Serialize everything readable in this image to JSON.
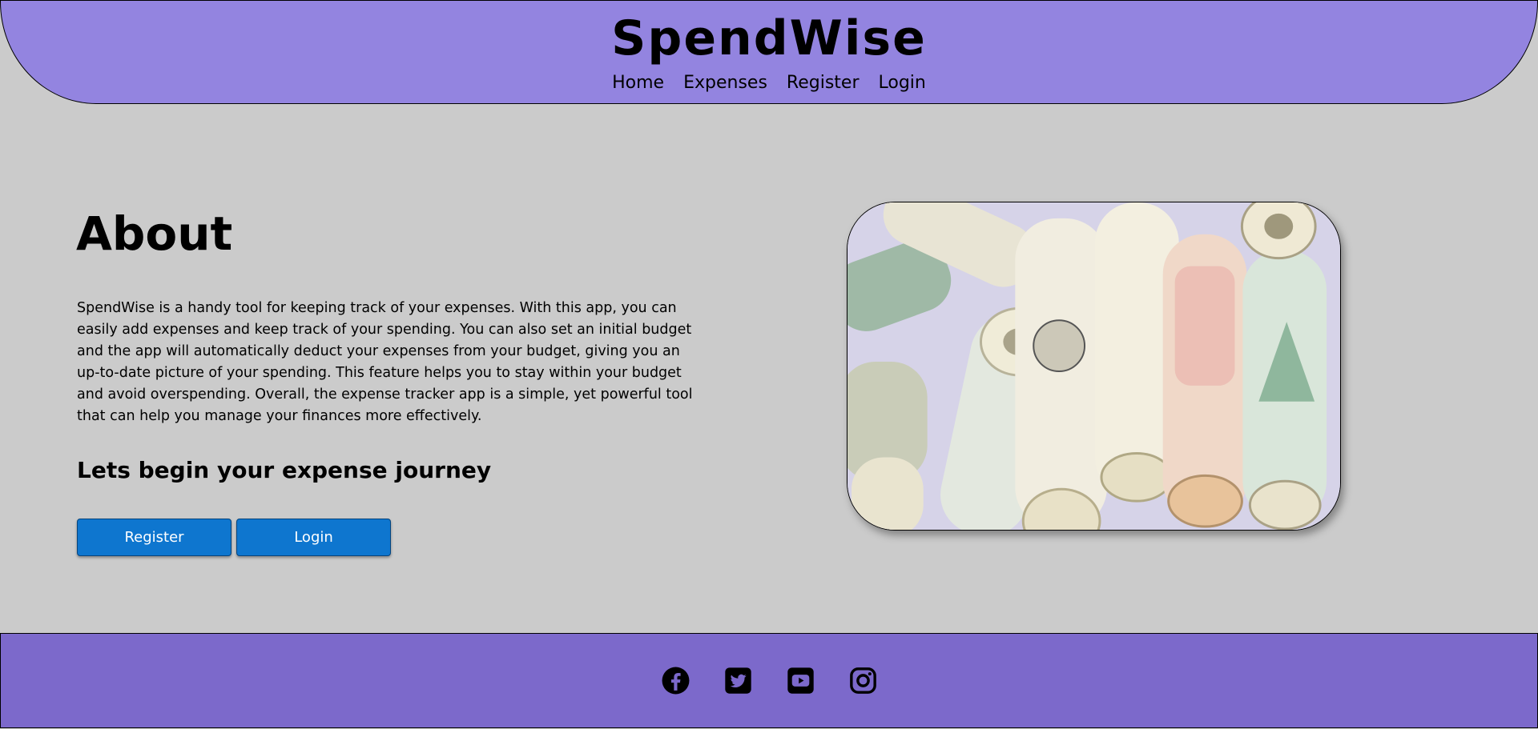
{
  "header": {
    "brand": "SpendWise",
    "nav": [
      "Home",
      "Expenses",
      "Register",
      "Login"
    ]
  },
  "about": {
    "title": "About",
    "text": "SpendWise is a handy tool for keeping track of your expenses. With this app, you can easily add expenses and keep track of your spending. You can also set an initial budget and the app will automatically deduct your expenses from your budget, giving you an up-to-date picture of your spending. This feature helps you to stay within your budget and avoid overspending. Overall, the expense tracker app is a simple, yet powerful tool that can help you manage your finances more effectively.",
    "cta_title": "Lets begin your expense journey",
    "register_label": "Register",
    "login_label": "Login"
  },
  "footer": {
    "icons": [
      "facebook-icon",
      "twitter-icon",
      "youtube-icon",
      "instagram-icon"
    ]
  },
  "colors": {
    "header_bg": "#9384e0",
    "footer_bg": "#7c69cb",
    "page_bg": "#cbcbcb",
    "button_bg": "#0e76cf"
  }
}
